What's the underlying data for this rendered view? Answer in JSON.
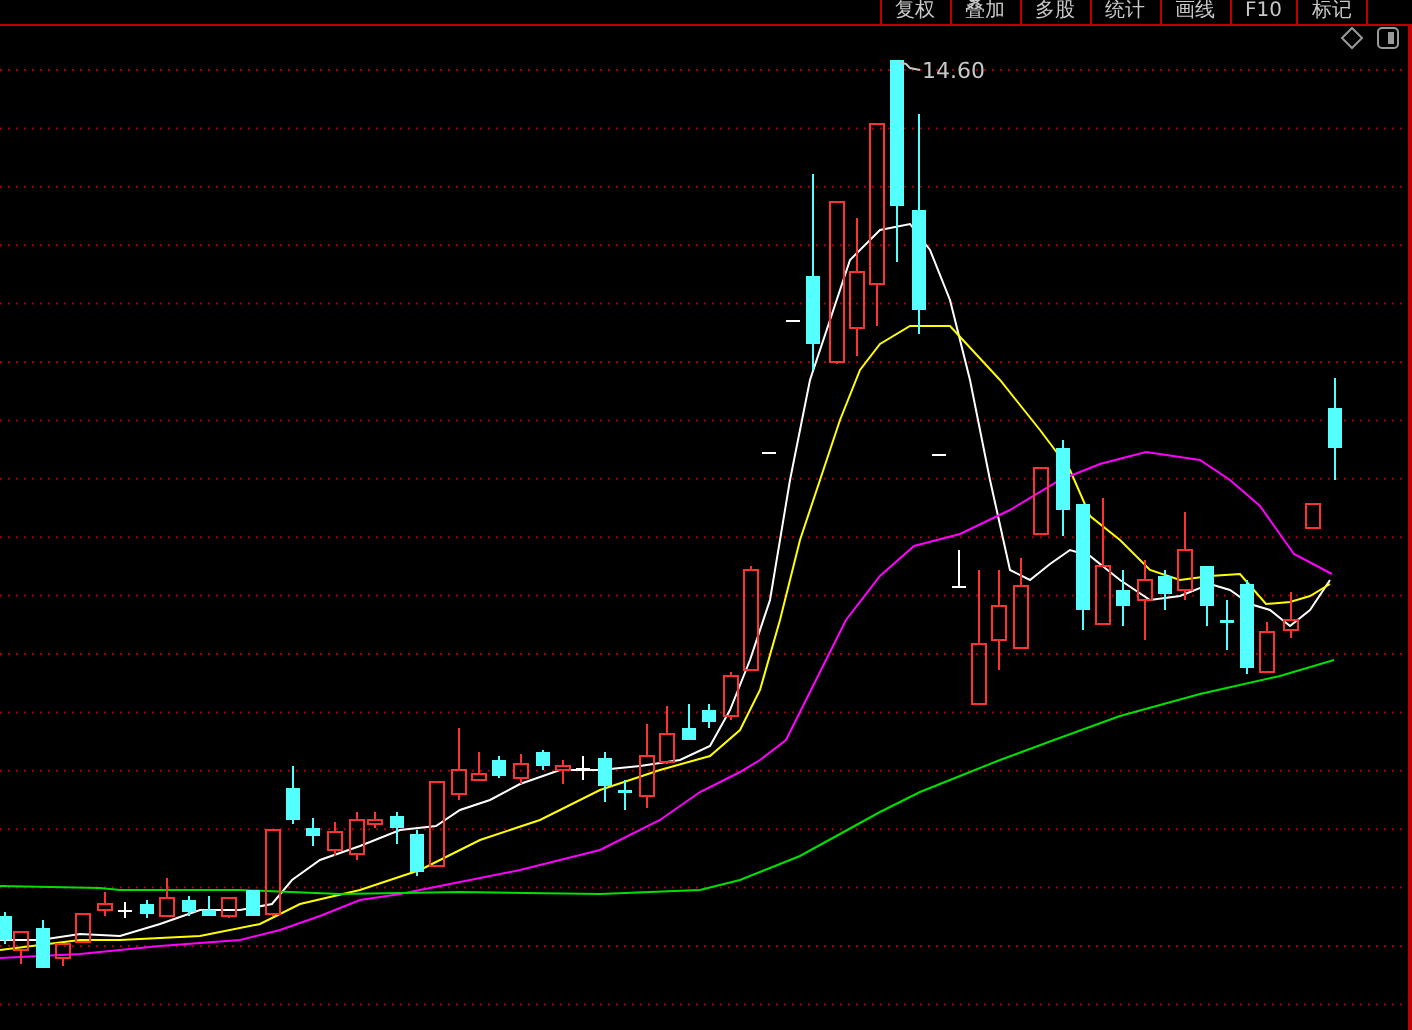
{
  "toolbar": {
    "tabs": [
      {
        "label": "复权"
      },
      {
        "label": "叠加"
      },
      {
        "label": "多股"
      },
      {
        "label": "统计"
      },
      {
        "label": "画线"
      },
      {
        "label": "F10"
      },
      {
        "label": "标记"
      }
    ]
  },
  "chart": {
    "high_label": "14.60"
  }
}
